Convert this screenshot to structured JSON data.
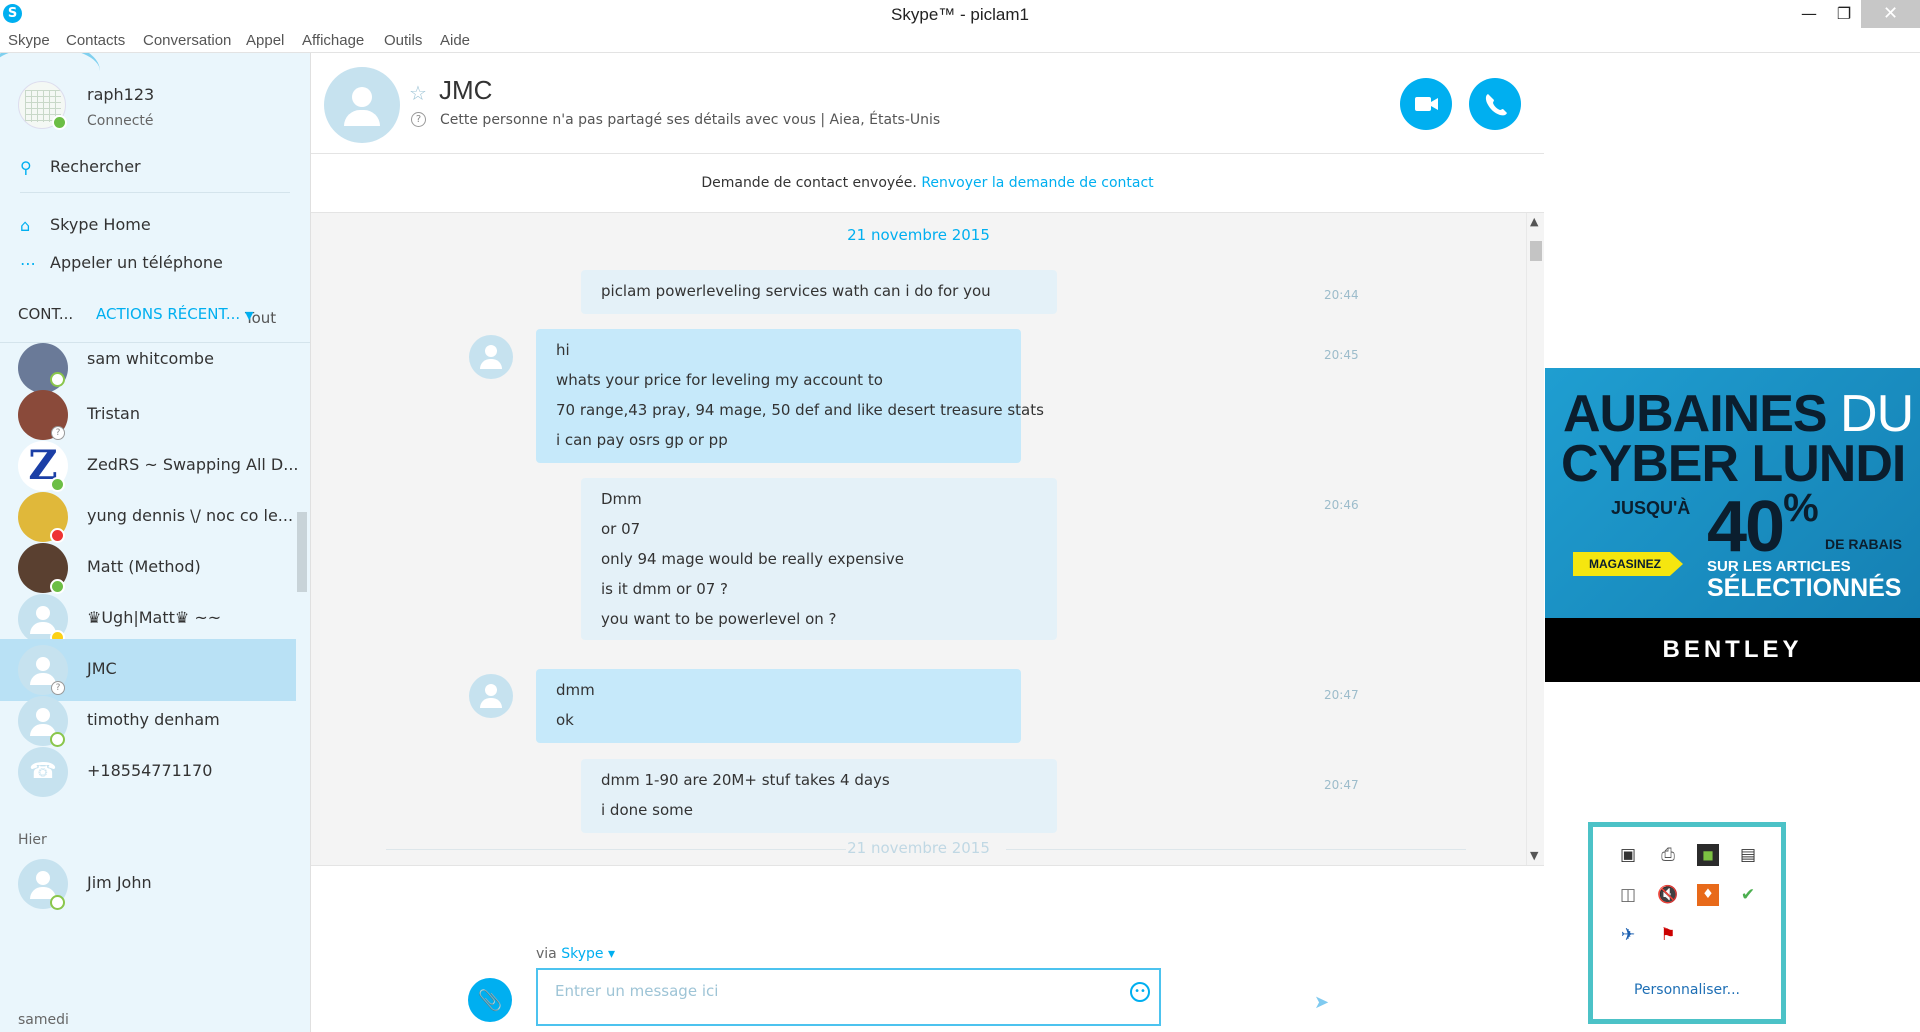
{
  "window": {
    "title": "Skype™ - piclam1",
    "minimize": "—",
    "maximize": "❐",
    "close": "✕",
    "app_icon": "S"
  },
  "menu": [
    "Skype",
    "Contacts",
    "Conversation",
    "Appel",
    "Affichage",
    "Outils",
    "Aide"
  ],
  "profile": {
    "name": "raph123",
    "status": "Connecté"
  },
  "search": {
    "label": "Rechercher"
  },
  "nav": {
    "home": "Skype Home",
    "call_phone": "Appeler un téléphone"
  },
  "tabs": {
    "contacts": "CONT...",
    "recent": "ACTIONS RÉCENT...",
    "filter": "Tout"
  },
  "contacts": [
    {
      "name": "sam whitcombe",
      "presence": "online"
    },
    {
      "name": "Tristan",
      "presence": "unknown"
    },
    {
      "name": "ZedRS ~ Swapping All D...",
      "presence": "online"
    },
    {
      "name": "yung dennis \\/ noc co le...",
      "presence": "dnd"
    },
    {
      "name": "Matt (Method)",
      "presence": "online"
    },
    {
      "name": "♛Ugh|Matt♛ ~~",
      "presence": "away-clock"
    },
    {
      "name": "JMC",
      "presence": "unknown"
    },
    {
      "name": "timothy denham",
      "presence": "away"
    },
    {
      "name": "+18554771170",
      "presence": "none"
    }
  ],
  "sections": {
    "yesterday": "Hier",
    "saturday": "samedi"
  },
  "contacts_yesterday": [
    {
      "name": "Jim John",
      "presence": "away"
    }
  ],
  "chat_header": {
    "name": "JMC",
    "info": "Cette personne n'a pas partagé ses détails avec vous  |  Aiea, États-Unis"
  },
  "contact_request": {
    "text": "Demande de contact envoyée.",
    "link": "Renvoyer la demande de contact"
  },
  "conversation": {
    "date": "21 novembre 2015",
    "date_bottom": "21 novembre 2015",
    "messages": [
      {
        "dir": "out",
        "time": "20:44",
        "lines": [
          "piclam powerleveling services wath can i do for you"
        ]
      },
      {
        "dir": "in",
        "time": "20:45",
        "lines": [
          "hi",
          "whats your price for leveling my account to",
          "70 range,43 pray, 94 mage, 50 def and like desert treasure stats",
          "i can pay osrs gp or pp"
        ]
      },
      {
        "dir": "out",
        "time": "20:46",
        "lines": [
          "Dmm",
          "or 07",
          "only 94 mage would be really expensive",
          "is it dmm or 07 ?",
          "you want to be powerlevel on ?"
        ]
      },
      {
        "dir": "in",
        "time": "20:47",
        "lines": [
          "dmm",
          "ok"
        ]
      },
      {
        "dir": "out",
        "time": "20:47",
        "lines": [
          "dmm 1-90 are 20M+ stuf takes 4 days",
          "i done some"
        ]
      }
    ]
  },
  "composer": {
    "via_prefix": "via",
    "via_link": "Skype ▾",
    "placeholder": "Entrer un message ici"
  },
  "ad": {
    "line1_bold": "AUBAINES",
    "line1_light": " DU",
    "line2": "CYBER LUNDI",
    "upto": "JUSQU'À",
    "percent": "40",
    "percent_sign": "%",
    "discount": "DE RABAIS",
    "shop": "MAGASINEZ",
    "on_items": "SUR LES ARTICLES",
    "selected": "SÉLECTIONNÉS",
    "brand": "BENTLEY"
  },
  "tray": {
    "customize": "Personnaliser..."
  },
  "colors": {
    "accent": "#00aff0",
    "sidebar_bg": "#eaf6fc",
    "selected": "#b9e1f5",
    "bubble_in": "#c6e9fa",
    "bubble_out": "#e4f1f8"
  }
}
